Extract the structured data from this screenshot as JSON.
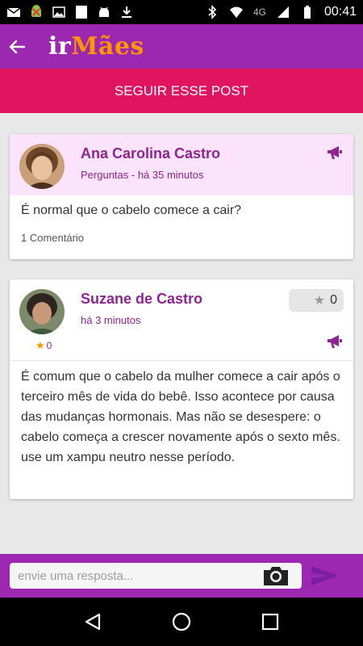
{
  "status_bar": {
    "network": "4G",
    "time": "00:41",
    "icons": [
      "email-icon",
      "android-download-icon",
      "image-icon",
      "blank-square-icon",
      "android-icon",
      "download-icon",
      "bluetooth-icon",
      "wifi-icon",
      "signal-icon",
      "battery-icon"
    ]
  },
  "app_bar": {
    "logo_part1": "ir",
    "logo_part2": "Mães",
    "back_icon": "arrow-left-icon"
  },
  "follow_button": {
    "label": "SEGUIR ESSE POST"
  },
  "question": {
    "author": "Ana Carolina Castro",
    "meta": "Perguntas - há 35 minutos",
    "text": "É normal que o cabelo comece a cair?",
    "comment_count": "1 Comentário"
  },
  "answer": {
    "author": "Suzane de Castro",
    "meta": "há 3 minutos",
    "author_stars": "0",
    "votes": "0",
    "text": "É comum que o cabelo da mulher comece a cair após o terceiro mês de vida do bebê. Isso acontece por causa das mudanças hormonais. Mas não se desespere: o cabelo começa a crescer novamente após o sexto mês. use um xampu neutro nesse período."
  },
  "reply": {
    "placeholder": "envie uma resposta..."
  },
  "colors": {
    "primary": "#9c27b0",
    "accent": "#e0145f",
    "logo_orange": "#ff9800",
    "author_purple": "#8e2590",
    "question_bg": "#fae3fb"
  }
}
